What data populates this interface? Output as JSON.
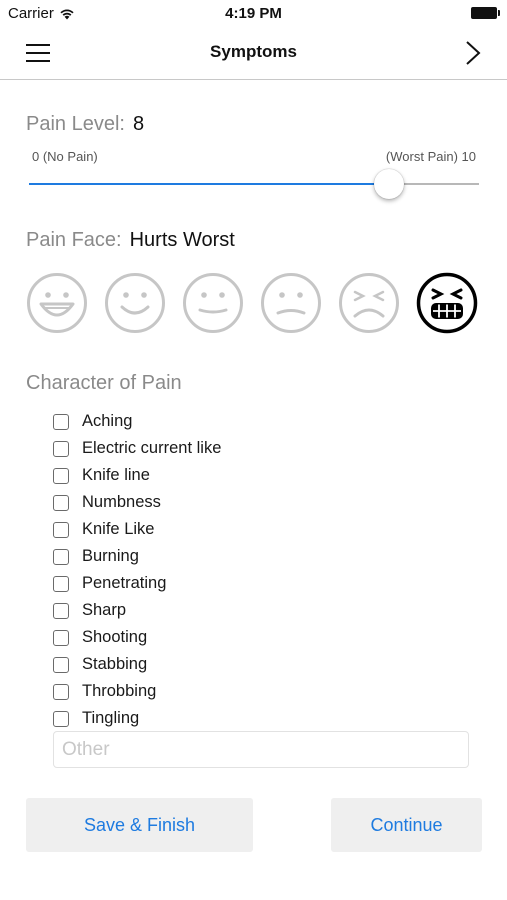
{
  "status_bar": {
    "carrier": "Carrier",
    "time": "4:19 PM",
    "wifi_icon": "wifi-icon",
    "battery_icon": "battery-icon"
  },
  "nav": {
    "title": "Symptoms",
    "menu_icon": "hamburger-menu-icon",
    "next_icon": "chevron-right-icon"
  },
  "pain_level": {
    "label": "Pain Level:",
    "value": "8",
    "min_label": "0 (No Pain)",
    "max_label": "(Worst Pain) 10",
    "slider_value": 8,
    "slider_min": 0,
    "slider_max": 10,
    "accent_color": "#1e7be0"
  },
  "pain_face": {
    "label": "Pain Face:",
    "value": "Hurts Worst",
    "faces": [
      {
        "icon": "face-no-hurt-icon",
        "selected": false
      },
      {
        "icon": "face-hurts-little-bit-icon",
        "selected": false
      },
      {
        "icon": "face-hurts-little-more-icon",
        "selected": false
      },
      {
        "icon": "face-hurts-even-more-icon",
        "selected": false
      },
      {
        "icon": "face-hurts-whole-lot-icon",
        "selected": false
      },
      {
        "icon": "face-hurts-worst-icon",
        "selected": true
      }
    ]
  },
  "character": {
    "label": "Character of Pain",
    "items": [
      "Aching",
      "Electric current like",
      "Knife line",
      "Numbness",
      "Knife Like",
      "Burning",
      "Penetrating",
      "Sharp",
      "Shooting",
      "Stabbing",
      "Throbbing",
      "Tingling"
    ],
    "other_placeholder": "Other",
    "other_value": ""
  },
  "buttons": {
    "save": "Save & Finish",
    "continue": "Continue"
  }
}
